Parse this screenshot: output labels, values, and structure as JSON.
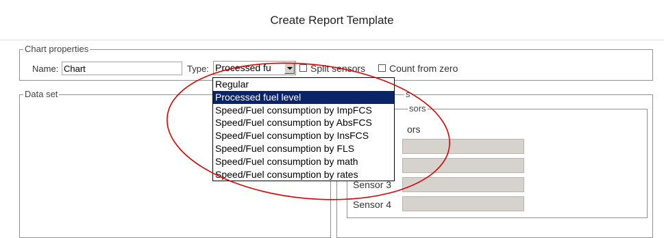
{
  "page": {
    "title": "Create Report Template"
  },
  "chart_properties": {
    "legend": "Chart properties",
    "name_label": "Name:",
    "name_value": "Chart",
    "type_label": "Type:",
    "type_value": "Processed fu",
    "split_sensors_label": "Split sensors",
    "count_from_zero_label": "Count from zero",
    "type_options": [
      "Regular",
      "Processed fuel level",
      "Speed/Fuel consumption by ImpFCS",
      "Speed/Fuel consumption by AbsFCS",
      "Speed/Fuel consumption by InsFCS",
      "Speed/Fuel consumption by FLS",
      "Speed/Fuel consumption by math",
      "Speed/Fuel consumption by rates"
    ],
    "selected_option_index": 1
  },
  "data_set": {
    "legend": "Data set"
  },
  "right_panel": {
    "legend_fragment": "s",
    "sensors_legend_fragment": "sors",
    "sensors_sub_fragment": "ors",
    "sensor3_label": "Sensor 3",
    "sensor4_label": "Sensor 4"
  },
  "annotation": {
    "color": "#e00000"
  }
}
